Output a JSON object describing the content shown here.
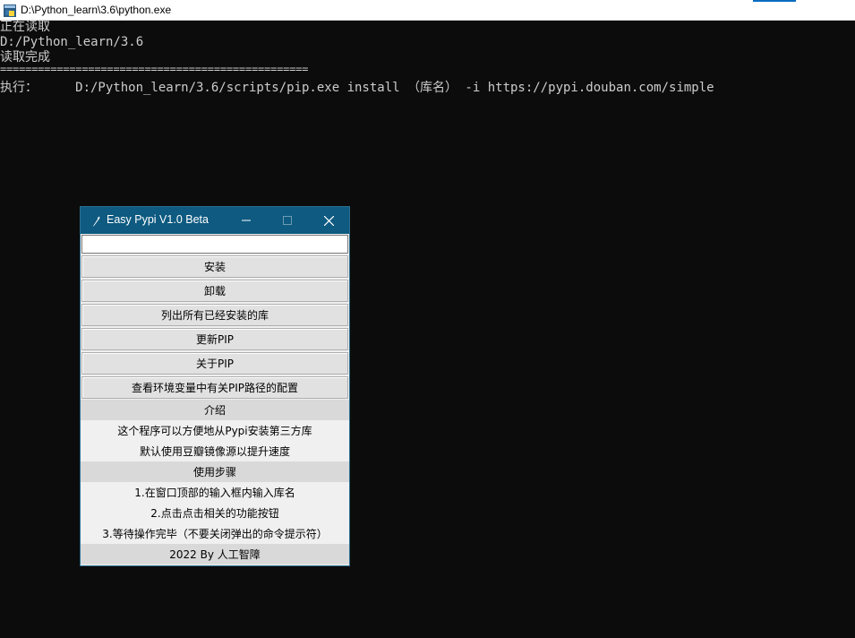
{
  "console": {
    "title": "D:\\Python_learn\\3.6\\python.exe",
    "icon": "python-console-icon",
    "lines": {
      "l1": "正在读取",
      "l2": "D:/Python_learn/3.6",
      "l3": "读取完成",
      "separator": "=================================================",
      "exec": "执行：     D:/Python_learn/3.6/scripts/pip.exe install （库名） -i https://pypi.douban.com/simple"
    }
  },
  "app": {
    "title": "Easy Pypi V1.0 Beta",
    "icon": "tk-feather-icon",
    "entry_value": "",
    "buttons": {
      "install": "安装",
      "uninstall": "卸载",
      "list": "列出所有已经安装的库",
      "update_pip": "更新PIP",
      "about_pip": "关于PIP",
      "env_config": "查看环境变量中有关PIP路径的配置"
    },
    "intro": {
      "heading": "介绍",
      "line1": "这个程序可以方便地从Pypi安装第三方库",
      "line2": "默认使用豆瓣镜像源以提升速度"
    },
    "steps": {
      "heading": "使用步骤",
      "step1": "1.在窗口顶部的输入框内输入库名",
      "step2": "2.点击点击相关的功能按钮",
      "step3": "3.等待操作完毕（不要关闭弹出的命令提示符）"
    },
    "footer": "2022 By 人工智障"
  },
  "colors": {
    "console_bg": "#0c0c0c",
    "console_text": "#cccccc",
    "tk_titlebar": "#0e5a80",
    "tk_bg": "#f0f0f0",
    "button_bg": "#e1e1e1",
    "section_bg": "#d9d9d9"
  }
}
